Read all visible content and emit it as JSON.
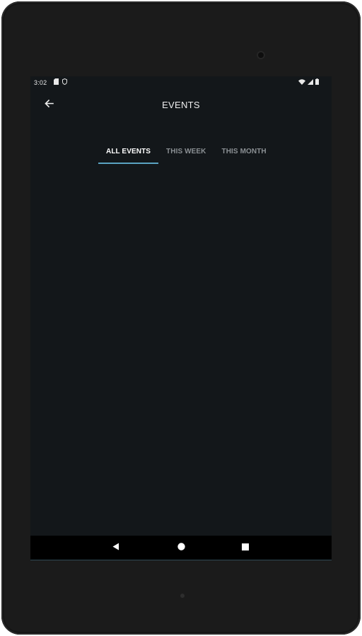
{
  "statusbar": {
    "time": "3:02",
    "left_icons": [
      "sd-card-icon",
      "shield-icon"
    ],
    "right_icons": [
      "wifi-icon",
      "signal-icon",
      "battery-icon"
    ]
  },
  "appbar": {
    "back_icon": "arrow-back-icon",
    "title": "EVENTS"
  },
  "tabs": [
    {
      "label": "ALL EVENTS",
      "active": true
    },
    {
      "label": "THIS WEEK",
      "active": false
    },
    {
      "label": "THIS MONTH",
      "active": false
    }
  ],
  "navbar": {
    "buttons": [
      "back-triangle-icon",
      "home-circle-icon",
      "recents-square-icon"
    ]
  },
  "colors": {
    "screen_bg": "#13171a",
    "device_bezel": "#1b1b1b",
    "tab_indicator": "#5ba3c2",
    "tab_inactive": "#8b9094"
  }
}
